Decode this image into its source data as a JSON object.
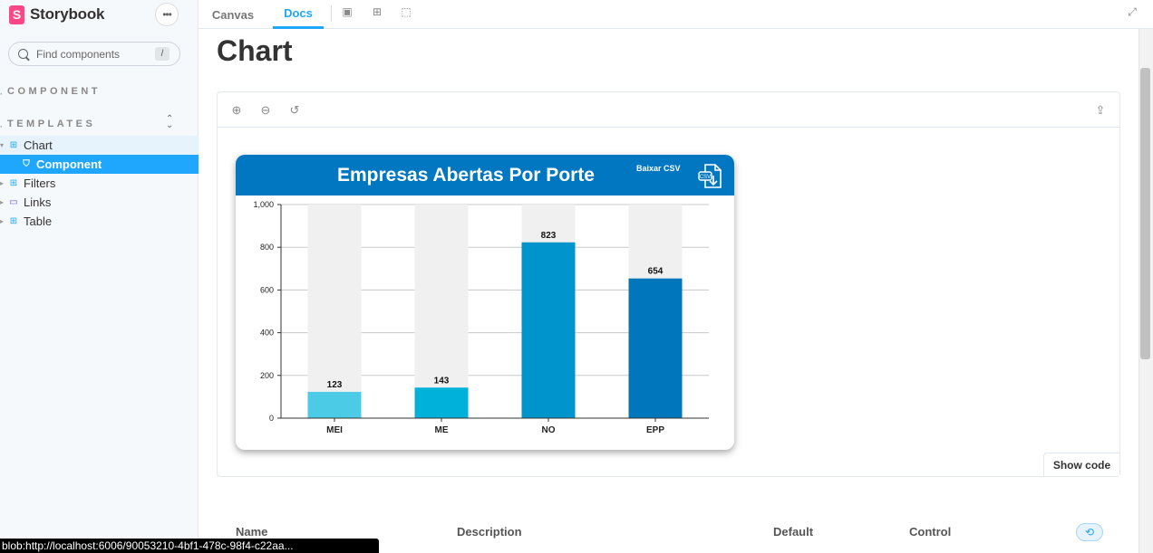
{
  "sidebar": {
    "brand": "Storybook",
    "brand_logo_letter": "S",
    "search_placeholder": "Find components",
    "search_shortcut": "/",
    "sections": [
      "COMPONENT",
      "TEMPLATES"
    ],
    "items": [
      {
        "label": "Chart",
        "icon": "component-icon"
      },
      {
        "label": "Component",
        "icon": "bookmark-icon"
      },
      {
        "label": "Filters",
        "icon": "component-icon"
      },
      {
        "label": "Links",
        "icon": "folder-icon"
      },
      {
        "label": "Table",
        "icon": "component-icon"
      }
    ]
  },
  "toolbar": {
    "tabs": [
      "Canvas",
      "Docs"
    ],
    "active_tab": "Docs"
  },
  "docs": {
    "title": "Chart",
    "show_code": "Show code",
    "args_headers": [
      "Name",
      "Description",
      "Default",
      "Control"
    ]
  },
  "chart_card": {
    "title": "Empresas Abertas Por Porte",
    "csv_label": "Baixar CSV",
    "csv_icon_text": "CSV"
  },
  "chart_data": {
    "type": "bar",
    "categories": [
      "MEI",
      "ME",
      "NO",
      "EPP"
    ],
    "values": [
      123,
      143,
      823,
      654
    ],
    "ylim": [
      0,
      1000
    ],
    "yticks": [
      0,
      200,
      400,
      600,
      800,
      1000
    ],
    "ytick_labels": [
      "0",
      "200",
      "400",
      "600",
      "800",
      "1,000"
    ],
    "colors": [
      "#4ccbe6",
      "#00b1d9",
      "#0094cc",
      "#0077bc"
    ],
    "background_bar_color": "#f0f0f0",
    "grid": true
  },
  "status_bar": {
    "url": "blob:http://localhost:6006/90053210-4bf1-478c-98f4-c22aa..."
  },
  "colors": {
    "accent": "#1ea7fd",
    "chart_header": "#0077c0"
  }
}
